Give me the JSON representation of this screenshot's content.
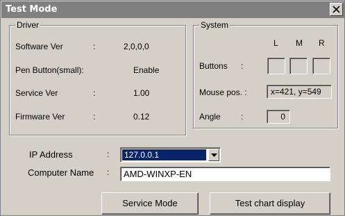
{
  "window": {
    "title": "Test Mode"
  },
  "driver": {
    "legend": "Driver",
    "rows": [
      {
        "label": "Software Ver",
        "sep": ":",
        "value": "2,0,0,0"
      },
      {
        "label": "Pen Button(small):",
        "sep": "",
        "value": "Enable"
      },
      {
        "label": "Service Ver",
        "sep": ":",
        "value": "1.00"
      },
      {
        "label": "Firmware Ver",
        "sep": ":",
        "value": "0.12"
      }
    ]
  },
  "system": {
    "legend": "System",
    "button_headers": [
      "L",
      "M",
      "R"
    ],
    "buttons_label": "Buttons",
    "buttons_sep": ":",
    "mouse_label": "Mouse pos. :",
    "mouse_value": "x=421, y=549",
    "angle_label": "Angle",
    "angle_sep": ":",
    "angle_value": "0"
  },
  "network": {
    "ip_label": "IP Address",
    "ip_sep": ":",
    "ip_value": "127.0.0.1",
    "computer_label": "Computer Name",
    "computer_sep": ":",
    "computer_value": "AMD-WINXP-EN"
  },
  "actions": {
    "service_mode": "Service Mode",
    "test_chart": "Test chart display"
  },
  "icons": {
    "close": "close-icon",
    "dropdown": "chevron-down-icon"
  }
}
